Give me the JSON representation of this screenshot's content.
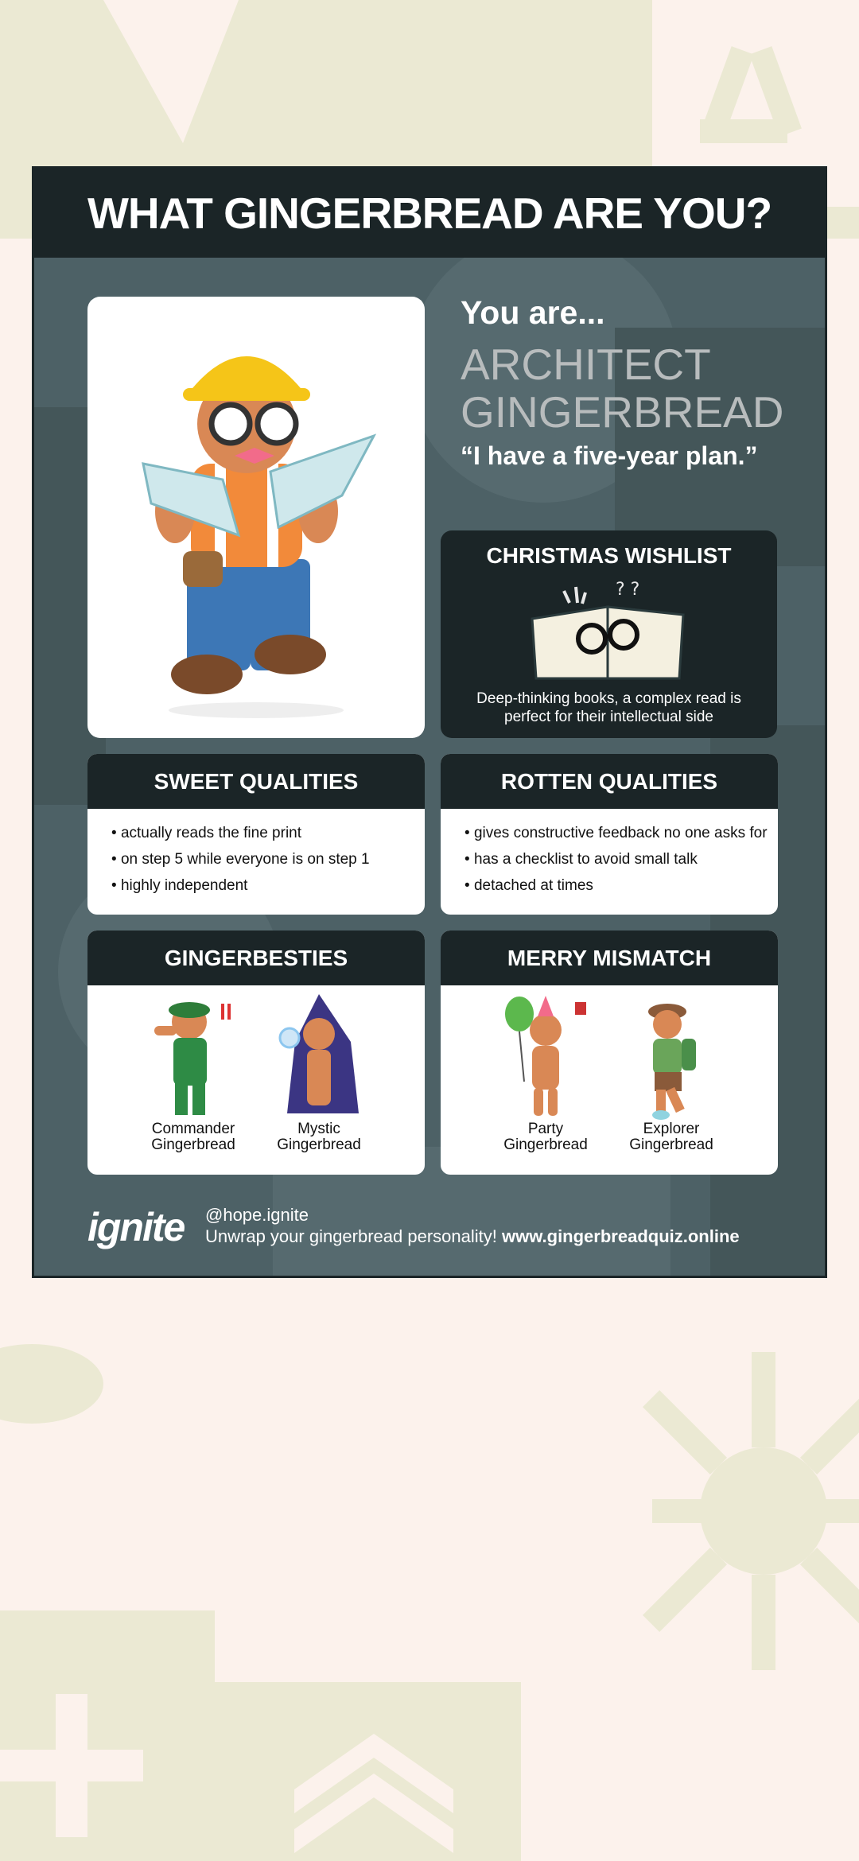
{
  "header": {
    "title": "WHAT GINGERBREAD ARE YOU?"
  },
  "result": {
    "intro": "You are...",
    "name_line1": "ARCHITECT",
    "name_line2": "GINGERBREAD",
    "quote": "“I have a five-year plan.”"
  },
  "wishlist": {
    "title": "CHRISTMAS WISHLIST",
    "text": "Deep-thinking books, a complex read is perfect for their intellectual side"
  },
  "sweet": {
    "title": "SWEET QUALITIES",
    "items": [
      "actually reads the fine print",
      "on step 5 while everyone is on step 1",
      "highly independent"
    ]
  },
  "rotten": {
    "title": "ROTTEN QUALITIES",
    "items": [
      "gives constructive feedback no one asks for",
      "has a checklist to avoid small talk",
      "detached at times"
    ]
  },
  "besties": {
    "title": "GINGERBESTIES",
    "characters": [
      {
        "line1": "Commander",
        "line2": "Gingerbread"
      },
      {
        "line1": "Mystic",
        "line2": "Gingerbread"
      }
    ]
  },
  "mismatch": {
    "title": "MERRY MISMATCH",
    "characters": [
      {
        "line1": "Party",
        "line2": "Gingerbread"
      },
      {
        "line1": "Explorer",
        "line2": "Gingerbread"
      }
    ]
  },
  "footer": {
    "logo": "ignite",
    "handle": "@hope.ignite",
    "tagline": "Unwrap your gingerbread personality!",
    "url": "www.gingerbreadquiz.online"
  },
  "colors": {
    "page_bg": "#fcf2ec",
    "decor": "#ebe9d3",
    "poster_bg": "#4d6166",
    "dark": "#1b2527",
    "muted_title": "#b8bcbd"
  },
  "icons": [
    "architect-gingerbread-illustration",
    "book-glasses-icon",
    "commander-gingerbread-icon",
    "mystic-gingerbread-icon",
    "party-gingerbread-icon",
    "explorer-gingerbread-icon"
  ]
}
